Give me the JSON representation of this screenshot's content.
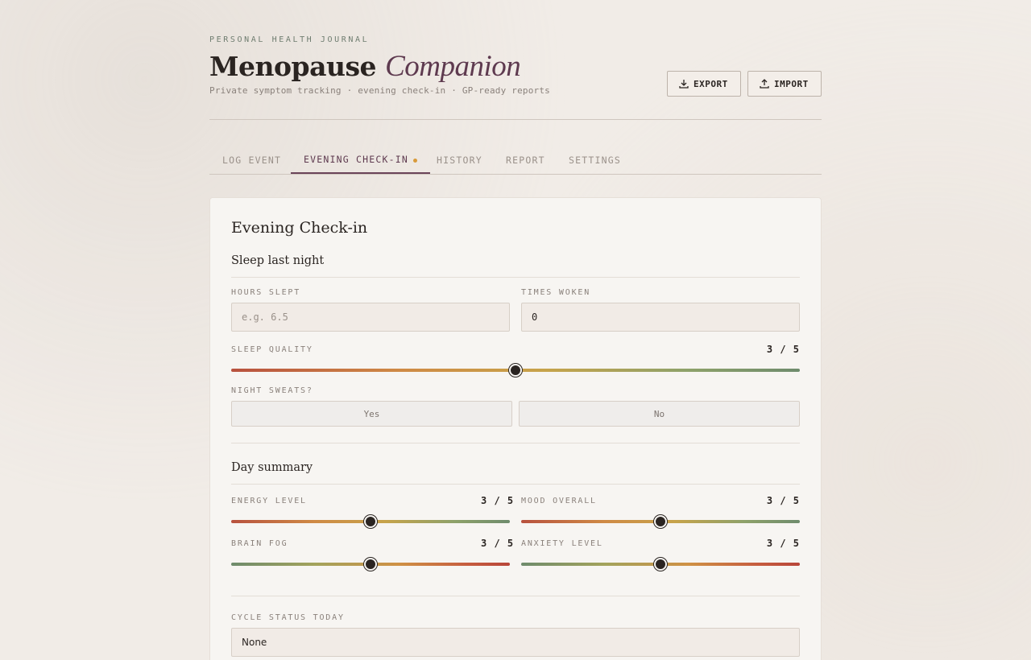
{
  "header": {
    "eyebrow": "PERSONAL HEALTH JOURNAL",
    "title_main": "Menopause",
    "title_accent": "Companion",
    "subtitle": "Private symptom tracking · evening check-in · GP-ready reports",
    "export_label": "EXPORT",
    "import_label": "IMPORT",
    "export_icon": "download-icon",
    "import_icon": "upload-icon"
  },
  "tabs": [
    {
      "label": "LOG EVENT",
      "active": false
    },
    {
      "label": "EVENING CHECK-IN",
      "active": true,
      "indicator": true
    },
    {
      "label": "HISTORY",
      "active": false
    },
    {
      "label": "REPORT",
      "active": false
    },
    {
      "label": "SETTINGS",
      "active": false
    }
  ],
  "checkin": {
    "title": "Evening Check-in",
    "sleep": {
      "section_title": "Sleep last night",
      "hours_label": "HOURS SLEPT",
      "hours_placeholder": "e.g. 6.5",
      "woken_label": "TIMES WOKEN",
      "woken_value": "0",
      "quality_label": "SLEEP QUALITY",
      "quality_value": "3 / 5",
      "quality_level": 3,
      "sweats_label": "NIGHT SWEATS?",
      "sweats_yes": "Yes",
      "sweats_no": "No"
    },
    "day": {
      "section_title": "Day summary",
      "energy_label": "ENERGY LEVEL",
      "energy_value": "3 / 5",
      "mood_label": "MOOD OVERALL",
      "mood_value": "3 / 5",
      "fog_label": "BRAIN FOG",
      "fog_value": "3 / 5",
      "anxiety_label": "ANXIETY LEVEL",
      "anxiety_value": "3 / 5",
      "scale_max": 5
    },
    "cycle": {
      "label": "CYCLE STATUS TODAY",
      "value": "None"
    }
  },
  "colors": {
    "accent": "#5e3a4f",
    "indicator": "#d89a3a",
    "background": "#f1ece7"
  }
}
